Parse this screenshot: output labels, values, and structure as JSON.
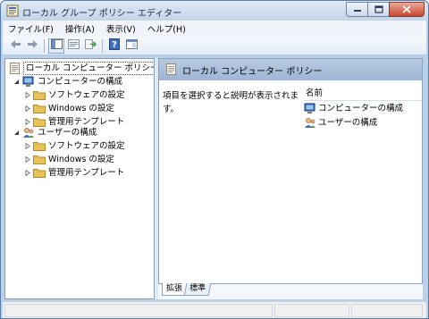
{
  "window": {
    "title": "ローカル グループ ポリシー エディター",
    "icons": {
      "app": "group-policy-icon",
      "minimize": "minimize-icon",
      "maximize": "maximize-icon",
      "close": "close-icon"
    }
  },
  "menu": {
    "items": [
      "ファイル(F)",
      "操作(A)",
      "表示(V)",
      "ヘルプ(H)"
    ]
  },
  "toolbar": {
    "buttons": [
      "back-arrow-icon",
      "forward-arrow-icon",
      "show-hide-tree-icon",
      "properties-icon",
      "export-list-icon",
      "help-icon",
      "extended-view-icon"
    ]
  },
  "tree": {
    "root": "ローカル コンピューター ポリシー",
    "computer": {
      "label": "コンピューターの構成",
      "children": [
        "ソフトウェアの設定",
        "Windows の設定",
        "管理用テンプレート"
      ]
    },
    "user": {
      "label": "ユーザーの構成",
      "children": [
        "ソフトウェアの設定",
        "Windows の設定",
        "管理用テンプレート"
      ]
    }
  },
  "detail": {
    "header": "ローカル コンピューター ポリシー",
    "description": "項目を選択すると説明が表示されます。",
    "column_name": "名前",
    "items": [
      "コンピューターの構成",
      "ユーザーの構成"
    ]
  },
  "tabs": [
    "拡張",
    "標準"
  ],
  "colors": {
    "header": "#a9bfdc",
    "frame": "#b9d1ea",
    "folder": "#e8c35a"
  }
}
